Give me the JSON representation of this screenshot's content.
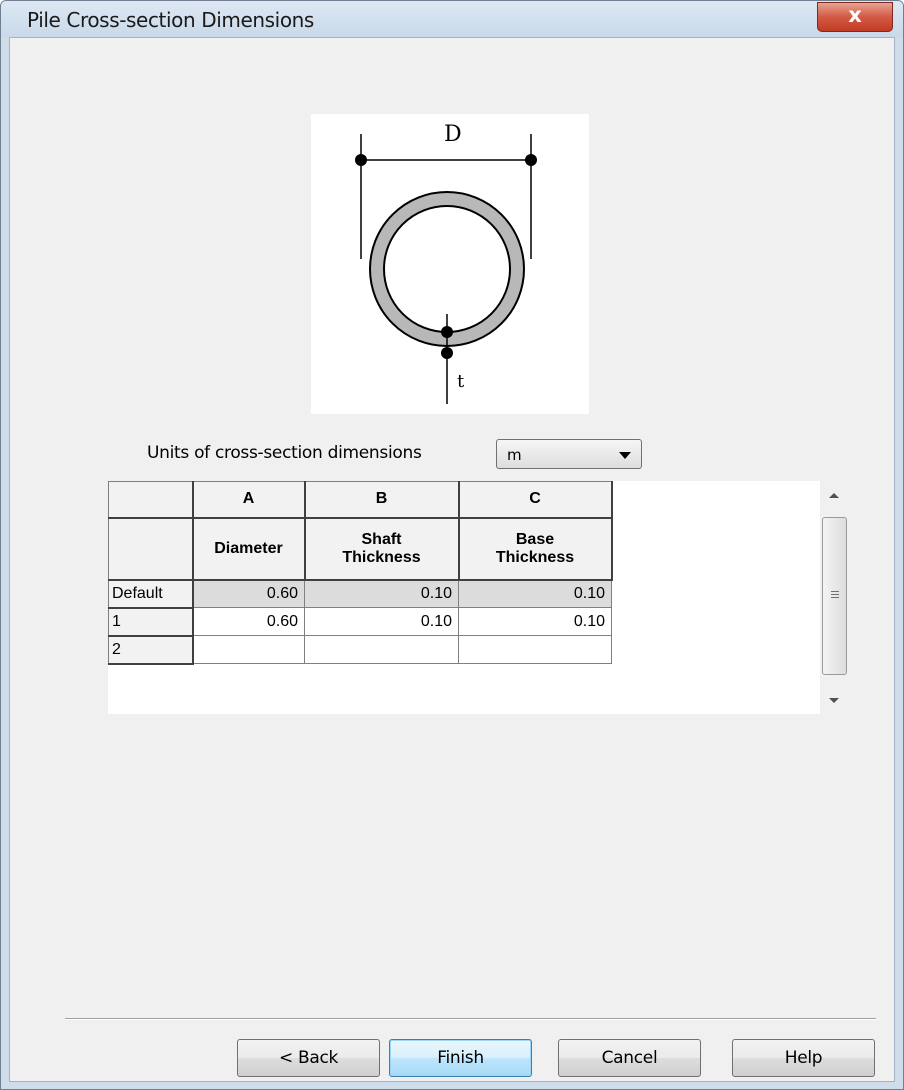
{
  "window": {
    "title": "Pile Cross-section Dimensions",
    "close_label": "x"
  },
  "diagram": {
    "label_D": "D",
    "label_t": "t"
  },
  "units": {
    "label": "Units of cross-section dimensions",
    "selected": "m"
  },
  "grid": {
    "column_letters": [
      "A",
      "B",
      "C"
    ],
    "column_names": [
      [
        "Diameter"
      ],
      [
        "Shaft",
        "Thickness"
      ],
      [
        "Base",
        "Thickness"
      ]
    ],
    "rows": [
      {
        "label": "Default",
        "values": [
          "0.60",
          "0.10",
          "0.10"
        ]
      },
      {
        "label": "1",
        "values": [
          "0.60",
          "0.10",
          "0.10"
        ]
      },
      {
        "label": "2",
        "values": [
          "",
          "",
          ""
        ]
      }
    ]
  },
  "buttons": {
    "back": "< Back",
    "finish": "Finish",
    "cancel": "Cancel",
    "help": "Help"
  }
}
